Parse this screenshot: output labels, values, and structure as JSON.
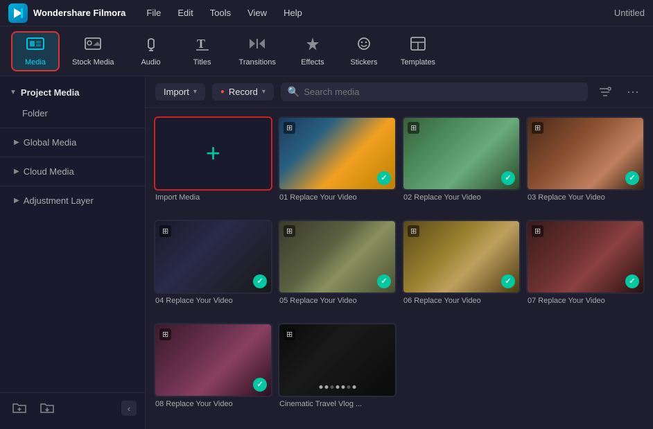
{
  "app": {
    "name": "Wondershare Filmora",
    "window_title": "Untitled"
  },
  "menu": {
    "items": [
      "File",
      "Edit",
      "Tools",
      "View",
      "Help"
    ]
  },
  "toolbar": {
    "items": [
      {
        "id": "media",
        "label": "Media",
        "active": true,
        "icon": "🎬"
      },
      {
        "id": "stock-media",
        "label": "Stock Media",
        "active": false,
        "icon": "🖼"
      },
      {
        "id": "audio",
        "label": "Audio",
        "active": false,
        "icon": "🎵"
      },
      {
        "id": "titles",
        "label": "Titles",
        "active": false,
        "icon": "T"
      },
      {
        "id": "transitions",
        "label": "Transitions",
        "active": false,
        "icon": "⇄"
      },
      {
        "id": "effects",
        "label": "Effects",
        "active": false,
        "icon": "✦"
      },
      {
        "id": "stickers",
        "label": "Stickers",
        "active": false,
        "icon": "🏷"
      },
      {
        "id": "templates",
        "label": "Templates",
        "active": false,
        "icon": "⊡"
      }
    ]
  },
  "sidebar": {
    "section_label": "Project Media",
    "items": [
      {
        "id": "folder",
        "label": "Folder"
      },
      {
        "id": "global-media",
        "label": "Global Media"
      },
      {
        "id": "cloud-media",
        "label": "Cloud Media"
      },
      {
        "id": "adjustment-layer",
        "label": "Adjustment Layer"
      }
    ],
    "footer_buttons": [
      {
        "id": "new-folder",
        "icon": "+"
      },
      {
        "id": "import-folder",
        "icon": "📂"
      }
    ],
    "collapse_icon": "‹"
  },
  "content": {
    "import_btn": "Import",
    "record_btn": "Record",
    "search_placeholder": "Search media",
    "filter_icon": "filter",
    "more_icon": "more",
    "media_items": [
      {
        "id": "import-media",
        "label": "Import Media",
        "type": "import"
      },
      {
        "id": "video-01",
        "label": "01 Replace Your Video",
        "type": "video",
        "thumb": "thumb-01"
      },
      {
        "id": "video-02",
        "label": "02 Replace Your Video",
        "type": "video",
        "thumb": "thumb-02"
      },
      {
        "id": "video-03",
        "label": "03 Replace Your Video",
        "type": "video",
        "thumb": "thumb-03"
      },
      {
        "id": "video-04",
        "label": "04 Replace Your Video",
        "type": "video",
        "thumb": "thumb-04"
      },
      {
        "id": "video-05",
        "label": "05 Replace Your Video",
        "type": "video",
        "thumb": "thumb-05"
      },
      {
        "id": "video-06",
        "label": "06 Replace Your Video",
        "type": "video",
        "thumb": "thumb-06"
      },
      {
        "id": "video-07",
        "label": "07 Replace Your Video",
        "type": "video",
        "thumb": "thumb-07"
      },
      {
        "id": "video-08",
        "label": "08 Replace Your Video",
        "type": "video",
        "thumb": "thumb-08"
      },
      {
        "id": "cinematic",
        "label": "Cinematic Travel Vlog ...",
        "type": "cinematic",
        "thumb": "thumb-cinematic"
      }
    ]
  }
}
